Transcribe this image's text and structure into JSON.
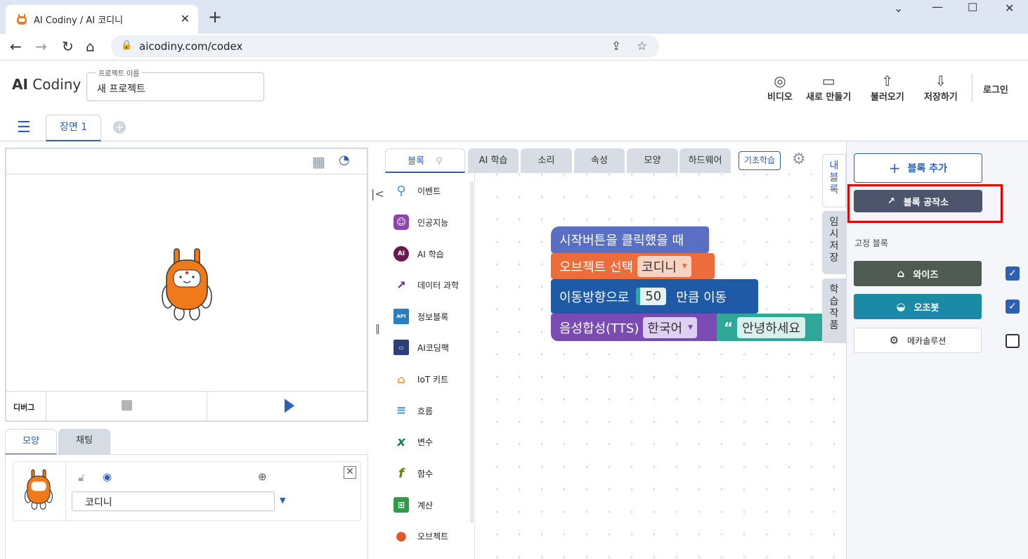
{
  "browser": {
    "tab_title": "AI Codiny / AI 코디니",
    "url": "aicodiny.com/codex"
  },
  "header": {
    "logo_bold": "AI",
    "logo_text": " Codiny",
    "project_label": "프로젝트 이름",
    "project_name": "새 프로젝트",
    "video": "비디오",
    "new": "새로 만들기",
    "load": "불러오기",
    "save": "저장하기",
    "login": "로그인"
  },
  "scene": {
    "tab": "장면 1"
  },
  "stage": {
    "debug": "디버그"
  },
  "object_panel": {
    "tabs": [
      "모양",
      "채팅"
    ],
    "object_name": "코디니"
  },
  "editor_tabs": [
    "블록",
    "AI 학습",
    "소리",
    "속성",
    "모양",
    "하드웨어"
  ],
  "basic_learning": "기초학습",
  "categories": [
    {
      "label": "이벤트",
      "icon": "pin-icon",
      "color": "#4a90e2"
    },
    {
      "label": "인공지능",
      "icon": "robot-icon",
      "color": "#8e44ad"
    },
    {
      "label": "AI 학습",
      "icon": "ai-icon",
      "color": "#6a1b4d"
    },
    {
      "label": "데이터 과학",
      "icon": "chart-icon",
      "color": "#6a1b9a"
    },
    {
      "label": "정보블록",
      "icon": "api-icon",
      "color": "#2a7fc0"
    },
    {
      "label": "AI코딩팩",
      "icon": "pack-icon",
      "color": "#2c3e7a"
    },
    {
      "label": "IoT 키트",
      "icon": "iot-icon",
      "color": "#e8a33d"
    },
    {
      "label": "흐름",
      "icon": "flow-icon",
      "color": "#3a8fd8"
    },
    {
      "label": "변수",
      "icon": "variable-icon",
      "color": "#1f7a5a"
    },
    {
      "label": "함수",
      "icon": "function-icon",
      "color": "#5a8a00"
    },
    {
      "label": "계산",
      "icon": "calc-icon",
      "color": "#2e9a4a"
    },
    {
      "label": "오브젝트",
      "icon": "object-icon",
      "color": "#e0592a"
    }
  ],
  "blocks": {
    "start": "시작버튼을 클릭했을 때",
    "select_prefix": "오브젝트 선택",
    "select_value": "코디니",
    "move_prefix": "이동방향으로",
    "move_value": "50",
    "move_suffix": "만큼 이동",
    "tts_prefix": "음성합성(TTS)",
    "tts_lang": "한국어",
    "tts_text": "안녕하세요"
  },
  "side_tabs": [
    "내 블록",
    "임시 저장",
    "학습 작품"
  ],
  "right_panel": {
    "add_block": "블록 추가",
    "workshop": "블록 공작소",
    "fixed_label": "고정 블록",
    "fixed_blocks": [
      {
        "label": "와이즈",
        "color": "#4f5a52",
        "checked": true
      },
      {
        "label": "오조봇",
        "color": "#1b8aa6",
        "checked": true
      },
      {
        "label": "메카솔루션",
        "color": "#ffffff",
        "checked": false
      }
    ]
  },
  "colors": {
    "accent": "#2d5fb5",
    "highlight": "#e00000",
    "event_block": "#5b6fc2",
    "object_block": "#ec6c3c",
    "motion_block": "#1e5aa6",
    "tts_block": "#7a4bb3",
    "text_block": "#2fa89a"
  }
}
